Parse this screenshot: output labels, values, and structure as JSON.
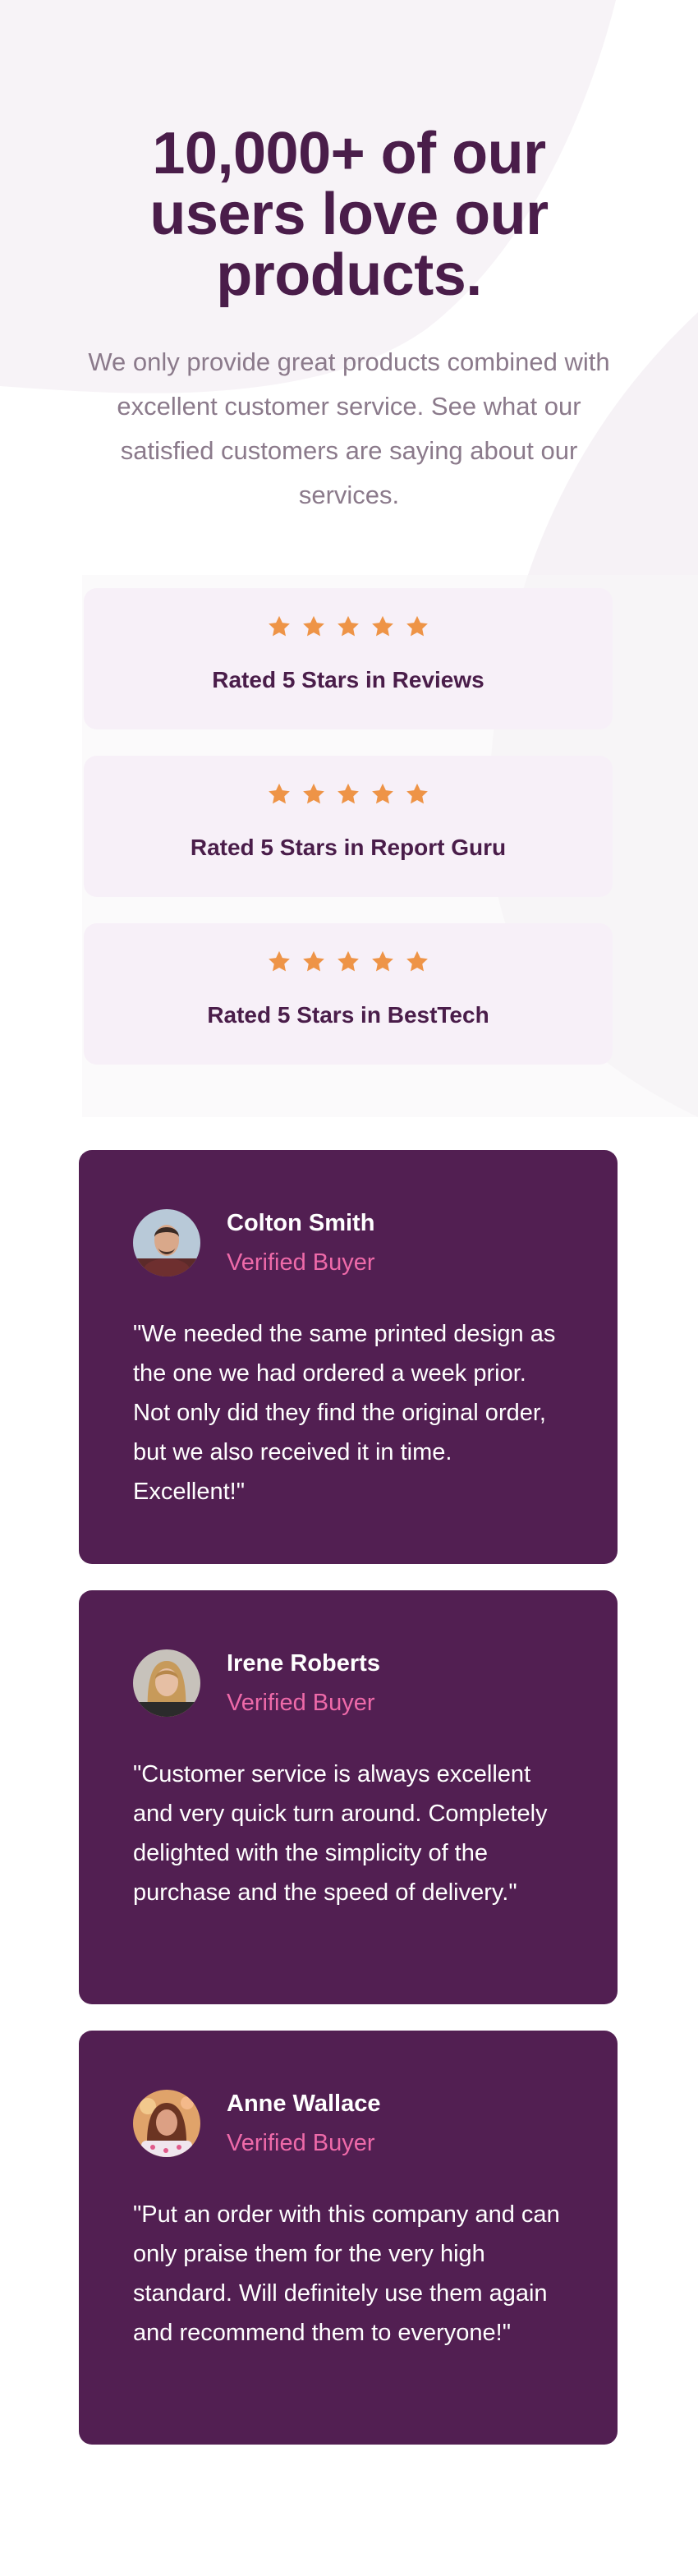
{
  "hero": {
    "title_line1": "10,000+ of our",
    "title_line2": "users love our",
    "title_line3": "products.",
    "description": "We only provide great products combined with excellent customer service. See what our satisfied customers are saying about our services."
  },
  "colors": {
    "dark_magenta": "#4a1d4a",
    "grayish_magenta": "#8b7a8b",
    "light_grayish_magenta": "#f7f0f8",
    "card_bg": "#521f52",
    "soft_pink": "#ee6aa9",
    "star_orange": "#ee9447"
  },
  "ratings": [
    {
      "stars": 5,
      "label": "Rated 5 Stars in Reviews"
    },
    {
      "stars": 5,
      "label": "Rated 5 Stars in Report Guru"
    },
    {
      "stars": 5,
      "label": "Rated 5 Stars in BestTech"
    }
  ],
  "testimonials": [
    {
      "name": "Colton Smith",
      "role": "Verified Buyer",
      "quote": "\"We needed the same printed design as the one we had ordered a week prior. Not only did they find the original order, but we also received it in time. Excellent!\""
    },
    {
      "name": "Irene Roberts",
      "role": "Verified Buyer",
      "quote": "\"Customer service is always excellent and very quick turn around. Completely delighted with the simplicity of the purchase and the speed of delivery.\""
    },
    {
      "name": "Anne Wallace",
      "role": "Verified Buyer",
      "quote": "\"Put an order with this company and can only praise them for the very high standard. Will definitely use them again and recommend them to everyone!\""
    }
  ]
}
